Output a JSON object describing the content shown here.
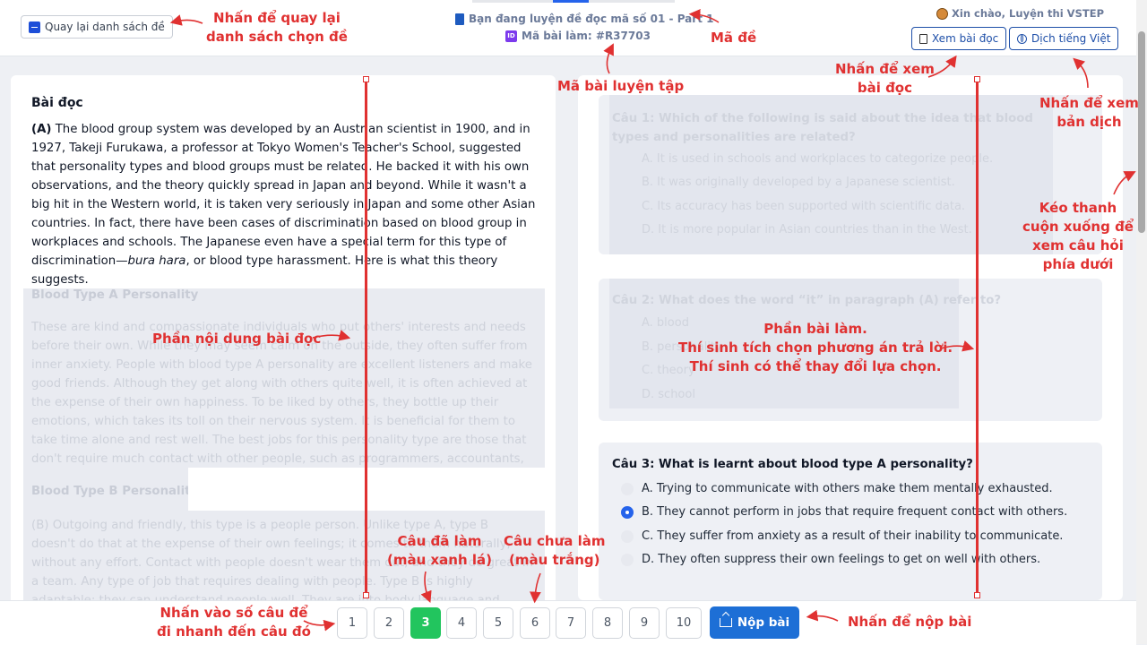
{
  "header": {
    "back_label": "Quay lại danh sách đề",
    "exam_title": "Bạn đang luyện đề đọc mã số 01 - Part 1",
    "exam_code": "Mã bài làm: #R37703",
    "greeting": "Xin chào, Luyện thi VSTEP",
    "view_reading_label": "Xem bài đọc",
    "translate_label": "Dịch tiếng Việt"
  },
  "reading": {
    "heading": "Bài đọc",
    "para_a_label": "(A)",
    "para_a_text": "The blood group system was developed by an Austrian scientist in 1900, and in 1927, Takeji Furukawa, a professor at Tokyo Women's Teacher's School, suggested that personality types and blood groups must be related. He backed it with his own observations, and the theory quickly spread in Japan and beyond. While it wasn't a big hit in the Western world, it is taken very seriously in Japan and some other Asian countries. In fact, there have been cases of discrimination based on blood group in workplaces and schools. The Japanese even have a special term for this type of discrimination—",
    "para_a_italic": "bura hara",
    "para_a_tail": ", or blood type harassment. Here is what this theory suggests.",
    "section_a_heading": "Blood Type A Personality",
    "section_a_text": "These are kind and compassionate individuals who put others' interests and needs before their own. While they may seem calm on the outside, they often suffer from inner anxiety. People with blood type A personality are excellent listeners and make good friends. Although they get along with others quite well, it is often achieved at the expense of their own happiness. To be liked by others, they bottle up their emotions, which takes its toll on their nervous system. It is beneficial for them to take time alone and rest well. The best jobs for this personality type are those that don't require much contact with other people, such as programmers, accountants, or librarians.",
    "section_b_heading": "Blood Type B Personality",
    "section_b_text": "(B) Outgoing and friendly, this type is a people person. Unlike type A, type B doesn't do that at the expense of their own feelings; it comes to them naturally, without any effort. Contact with people doesn't wear them out, and they do great in a team. Any type of job that requires dealing with people. Type B is highly adaptable; they can understand people well. They are into body language and other methods of deciphering other"
  },
  "questions": [
    {
      "text": "Câu 1: Which of the following is said about the idea that blood types and personalities are related?",
      "options": [
        "A. It is used in schools and workplaces to categorize people.",
        "B. It was originally developed by a Japanese scientist.",
        "C. Its accuracy has been supported with scientific data.",
        "D. It is more popular in Asian countries than in the West."
      ]
    },
    {
      "text": "Câu 2: What does the word “it” in paragraph (A) refer to?",
      "options": [
        "A. blood",
        "B. personality",
        "C. theory",
        "D. school"
      ]
    },
    {
      "text": "Câu 3: What is learnt about blood type A personality?",
      "options": [
        "A. Trying to communicate with others make them mentally exhausted.",
        "B. They cannot perform in jobs that require frequent contact with others.",
        "C. They suffer from anxiety as a result of their inability to communicate.",
        "D. They often suppress their own feelings to get on well with others."
      ],
      "selected_index": 1
    }
  ],
  "nav": {
    "numbers": [
      "1",
      "2",
      "3",
      "4",
      "5",
      "6",
      "7",
      "8",
      "9",
      "10"
    ],
    "done_index": 2,
    "submit_label": "Nộp bài"
  },
  "annotations": {
    "back": "Nhấn để quay lại\ndanh sách chọn đề",
    "exam_code": "Mã đề",
    "practice_code": "Mã bài luyện tập",
    "view_reading": "Nhấn để xem\nbài đọc",
    "translate": "Nhấn để xem\nbản dịch",
    "scroll": "Kéo thanh\ncuộn xuống để\nxem câu hỏi\nphía dưới",
    "reading_content": "Phần nội dung bài đọc",
    "answer_area": "Phần bài làm.\nThí sinh tích chọn phương án trả lời.\nThí sinh có thể thay đổi lựa chọn.",
    "done": "Câu đã làm\n(màu xanh lá)",
    "undone": "Câu chưa làm\n(màu trắng)",
    "jump": "Nhấn vào số câu để\nđi nhanh đến câu đó",
    "submit": "Nhấn để nộp bài"
  },
  "colors": {
    "annotation": "#e03131",
    "done_green": "#22c55e",
    "primary_blue": "#1d6fd6"
  }
}
